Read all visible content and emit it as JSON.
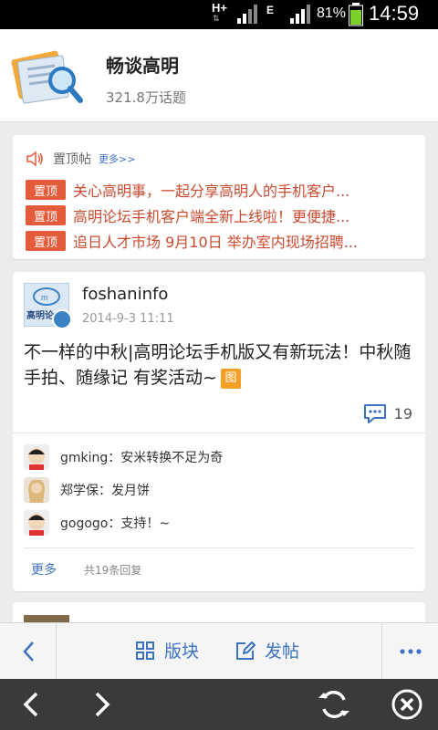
{
  "status_bar": {
    "network": "H+",
    "edge": "E",
    "battery": "81%",
    "time": "14:59",
    "icons": [
      "signal-icon",
      "battery-icon"
    ]
  },
  "header": {
    "title": "畅谈高明",
    "topic_count": "321.8万话题",
    "logo_icon": "forum-logo-icon"
  },
  "pinned": {
    "label": "置顶帖",
    "more": "更多>>",
    "icon": "speaker-icon",
    "items": [
      {
        "tag": "置顶",
        "text": "关心高明事，一起分享高明人的手机客户..."
      },
      {
        "tag": "置顶",
        "text": "高明论坛手机客户端全新上线啦！更便捷..."
      },
      {
        "tag": "置顶",
        "text": "追日人才市场 9月10日 举办室内现场招聘..."
      }
    ],
    "colors": {
      "tag_bg": "#e35b3a",
      "text": "#c94a2e"
    }
  },
  "post": {
    "author": "foshaninfo",
    "time": "2014-9-3 11:11",
    "avatar_text": "高明论",
    "content": "不一样的中秋|高明论坛手机版又有新玩法！中秋随手拍、随缘记 有奖活动~",
    "image_tag": "图",
    "comment_count": "19",
    "replies": [
      {
        "user": "gmking",
        "text": "gmking：安米转换不足为奇"
      },
      {
        "user": "郑学保",
        "text": "郑学保：发月饼"
      },
      {
        "user": "gogogo",
        "text": "gogogo：支持！~"
      }
    ],
    "more": "更多",
    "total": "共19条回复"
  },
  "actionbar": {
    "board": "版块",
    "post": "发帖",
    "accent": "#3d72c2"
  },
  "browserbar": {
    "icons": [
      "back-arrow-icon",
      "forward-arrow-icon",
      "refresh-icon",
      "close-icon"
    ]
  }
}
